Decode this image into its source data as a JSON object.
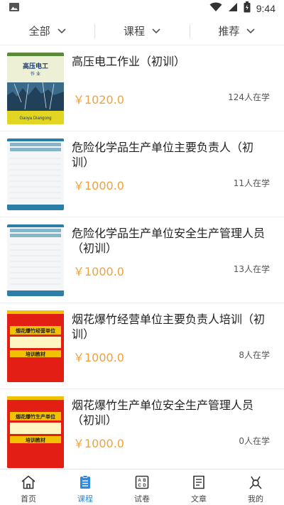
{
  "status_bar": {
    "time": "9:44",
    "icons": [
      "image-notification-icon",
      "wifi-icon",
      "signal-icon",
      "battery-icon"
    ]
  },
  "filters": [
    {
      "label": "全部"
    },
    {
      "label": "课程"
    },
    {
      "label": "推荐"
    }
  ],
  "courses": [
    {
      "title": "高压电工作业（初训）",
      "price": "￥1020.0",
      "learners": "124人在学",
      "cover": {
        "main_text": "高压电工",
        "sub_text": "Gaoya Diangong"
      }
    },
    {
      "title": "危险化学品生产单位主要负责人（初训）",
      "price": "￥1000.0",
      "learners": "11人在学",
      "cover": {
        "main_text": "",
        "sub_text": ""
      }
    },
    {
      "title": "危险化学品生产单位安全生产管理人员（初训）",
      "price": "￥1000.0",
      "learners": "13人在学",
      "cover": {
        "main_text": "",
        "sub_text": ""
      }
    },
    {
      "title": "烟花爆竹经营单位主要负责人培训（初训）",
      "price": "￥1000.0",
      "learners": "8人在学",
      "cover": {
        "main_text": "烟花爆竹经营单位",
        "sub_text": "培训教材"
      }
    },
    {
      "title": "烟花爆竹生产单位安全生产管理人员（初训）",
      "price": "￥1000.0",
      "learners": "0人在学",
      "cover": {
        "main_text": "烟花爆竹生产单位",
        "sub_text": "培训教材"
      }
    }
  ],
  "bottom_nav": [
    {
      "label": "首页",
      "icon": "home-icon",
      "active": false
    },
    {
      "label": "课程",
      "icon": "course-icon",
      "active": true
    },
    {
      "label": "试卷",
      "icon": "exam-icon",
      "active": false
    },
    {
      "label": "文章",
      "icon": "article-icon",
      "active": false
    },
    {
      "label": "我的",
      "icon": "profile-icon",
      "active": false
    }
  ],
  "colors": {
    "accent": "#2d8ae0",
    "price": "#f0a23a",
    "divider": "#efefef"
  }
}
